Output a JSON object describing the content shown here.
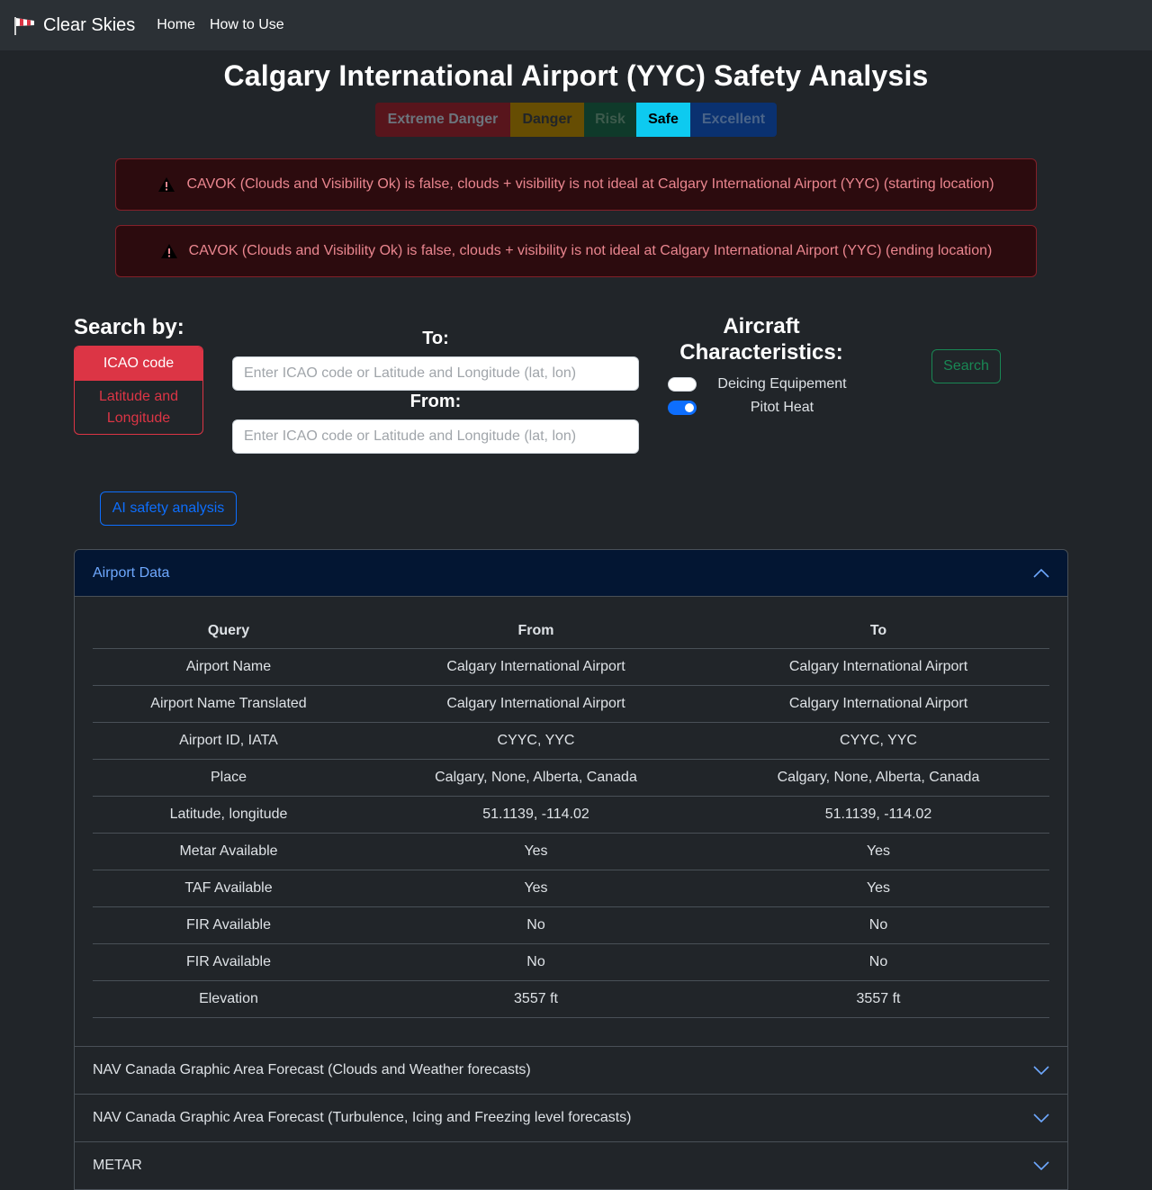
{
  "navbar": {
    "brand": "Clear Skies",
    "links": [
      "Home",
      "How to Use"
    ]
  },
  "page": {
    "title": "Calgary International Airport (YYC) Safety Analysis"
  },
  "safety_scale": {
    "levels": [
      "Extreme Danger",
      "Danger",
      "Risk",
      "Safe",
      "Excellent"
    ],
    "active": "Safe"
  },
  "alerts": [
    "CAVOK (Clouds and Visibility Ok) is false, clouds + visibility is not ideal at Calgary International Airport (YYC) (starting location)",
    "CAVOK (Clouds and Visibility Ok) is false, clouds + visibility is not ideal at Calgary International Airport (YYC) (ending location)"
  ],
  "search": {
    "label": "Search by:",
    "modes": [
      "ICAO code",
      "Latitude and Longitude"
    ],
    "active_mode": "ICAO code",
    "to_label": "To:",
    "from_label": "From:",
    "to_value": "",
    "from_value": "",
    "placeholder": "Enter ICAO code or Latitude and Longitude (lat, lon)",
    "button": "Search"
  },
  "aircraft": {
    "title": "Aircraft Characteristics:",
    "toggles": [
      {
        "label": "Deicing Equipement",
        "checked": false
      },
      {
        "label": "Pitot Heat",
        "checked": true
      }
    ]
  },
  "ai_button": "AI safety analysis",
  "accordion": {
    "open_section": "Airport Data",
    "table": {
      "headers": [
        "Query",
        "From",
        "To"
      ],
      "rows": [
        [
          "Airport Name",
          "Calgary International Airport",
          "Calgary International Airport"
        ],
        [
          "Airport Name Translated",
          "Calgary International Airport",
          "Calgary International Airport"
        ],
        [
          "Airport ID, IATA",
          "CYYC, YYC",
          "CYYC, YYC"
        ],
        [
          "Place",
          "Calgary, None, Alberta, Canada",
          "Calgary, None, Alberta, Canada"
        ],
        [
          "Latitude, longitude",
          "51.1139, -114.02",
          "51.1139, -114.02"
        ],
        [
          "Metar Available",
          "Yes",
          "Yes"
        ],
        [
          "TAF Available",
          "Yes",
          "Yes"
        ],
        [
          "FIR Available",
          "No",
          "No"
        ],
        [
          "FIR Available",
          "No",
          "No"
        ],
        [
          "Elevation",
          "3557 ft",
          "3557 ft"
        ]
      ]
    },
    "collapsed_sections": [
      "NAV Canada Graphic Area Forecast (Clouds and Weather forecasts)",
      "NAV Canada Graphic Area Forecast (Turbulence, Icing and Freezing level forecasts)",
      "METAR"
    ]
  },
  "colors": {
    "background": "#212529",
    "navbar": "#2b3035",
    "danger": "#dc3545",
    "safe_active": "#0dcaf0",
    "success": "#198754",
    "primary": "#0d6efd"
  }
}
